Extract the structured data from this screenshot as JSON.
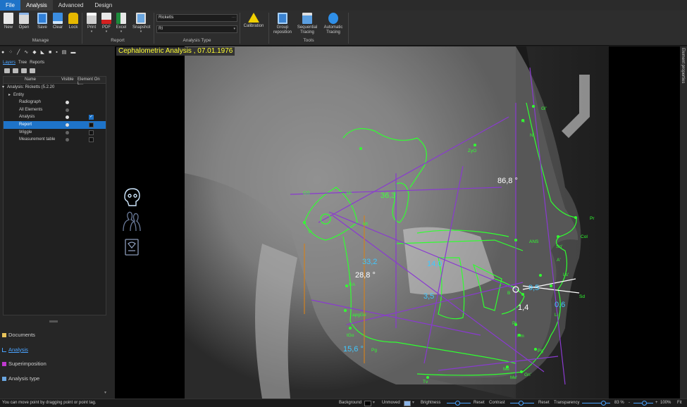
{
  "menu": {
    "tabs": [
      "File",
      "Analysis",
      "Advanced",
      "Design"
    ],
    "active": "Analysis"
  },
  "ribbon": {
    "manage": {
      "label": "Manage",
      "buttons": [
        "New",
        "Open",
        "Save",
        "Clear",
        "Lock"
      ]
    },
    "report": {
      "label": "Report",
      "buttons": [
        "Print",
        "PDF",
        "Excel",
        "Snapshot"
      ]
    },
    "analysis_type": {
      "label": "Analysis Type",
      "combo1": "Ricketts",
      "combo2": "RI"
    },
    "calibration": "Calibration",
    "tools": {
      "label": "Tools",
      "buttons": [
        "Group\nreposition",
        "Sequential\nTracing",
        "Automatic\nTracing"
      ]
    }
  },
  "left_panel": {
    "tabs": [
      "Layers",
      "Tree",
      "Reports"
    ],
    "active_tab": "Layers",
    "columns": [
      "Name",
      "Visible",
      "Element On L..."
    ],
    "rows": [
      {
        "label": "Analysis: Ricketts (5.2.20",
        "level": 0,
        "expander": "▾"
      },
      {
        "label": "Entity",
        "level": 1,
        "expander": "▸"
      },
      {
        "label": "Radiograph",
        "level": 2,
        "visible": true
      },
      {
        "label": "All Elements",
        "level": 2,
        "visible": false
      },
      {
        "label": "Analysis",
        "level": 2,
        "visible": true,
        "element_on": true
      },
      {
        "label": "Report",
        "level": 2,
        "visible": true,
        "element_on": false,
        "selected": true
      },
      {
        "label": "Wiggle",
        "level": 2,
        "visible": false,
        "element_on": false
      },
      {
        "label": "Measurement table",
        "level": 2,
        "visible": false,
        "element_on": false
      }
    ],
    "nav": [
      "Documents",
      "Analysis",
      "Superimposition",
      "Analysis type"
    ],
    "active_nav": "Analysis"
  },
  "viewer": {
    "title": "Cephalometric Analysis  , 07.01.1976",
    "measurements": [
      {
        "text": "86,8 °",
        "color": "#ffffff"
      },
      {
        "text": "33,2",
        "color": "#40c8ff"
      },
      {
        "text": "28,8 °",
        "color": "#ffffff"
      },
      {
        "text": "15,6 °",
        "color": "#40c8ff"
      },
      {
        "text": "1,4",
        "color": "#ffffff"
      },
      {
        "text": "0,6",
        "color": "#40c8ff"
      },
      {
        "text": "14,0",
        "color": "#40c8ff"
      },
      {
        "text": "3,5",
        "color": "#40c8ff"
      },
      {
        "text": "9,5",
        "color": "#40c8ff"
      },
      {
        "text": "36,3",
        "color": "#40ff40"
      }
    ],
    "points": [
      "Gl'",
      "N",
      "N'",
      "ZyO",
      "Pr",
      "Mi",
      "Mt",
      "CoI",
      "Sn'",
      "ANS",
      "A'",
      "Ls'",
      "Sd",
      "B",
      "Li",
      "Pm",
      "Pg'",
      "Me",
      "Me'",
      "Gn'",
      "Tv",
      "tGo",
      "Pg",
      "apgGo",
      "RA",
      "CG",
      "Vi",
      "Pt"
    ]
  },
  "right_strip": "Element properties",
  "status": {
    "hint": "You can move point by dragging point or point tag.",
    "background_label": "Background",
    "unmoved_label": "Unmoved",
    "brightness_label": "Brightness",
    "reset1": "Reset",
    "contrast_label": "Contrast",
    "reset2": "Reset",
    "transparency_label": "Transparency",
    "transparency_value": "83 %",
    "zoom_minus": "-",
    "zoom_plus": "+",
    "zoom_value": "100%",
    "fit": "Fit"
  }
}
